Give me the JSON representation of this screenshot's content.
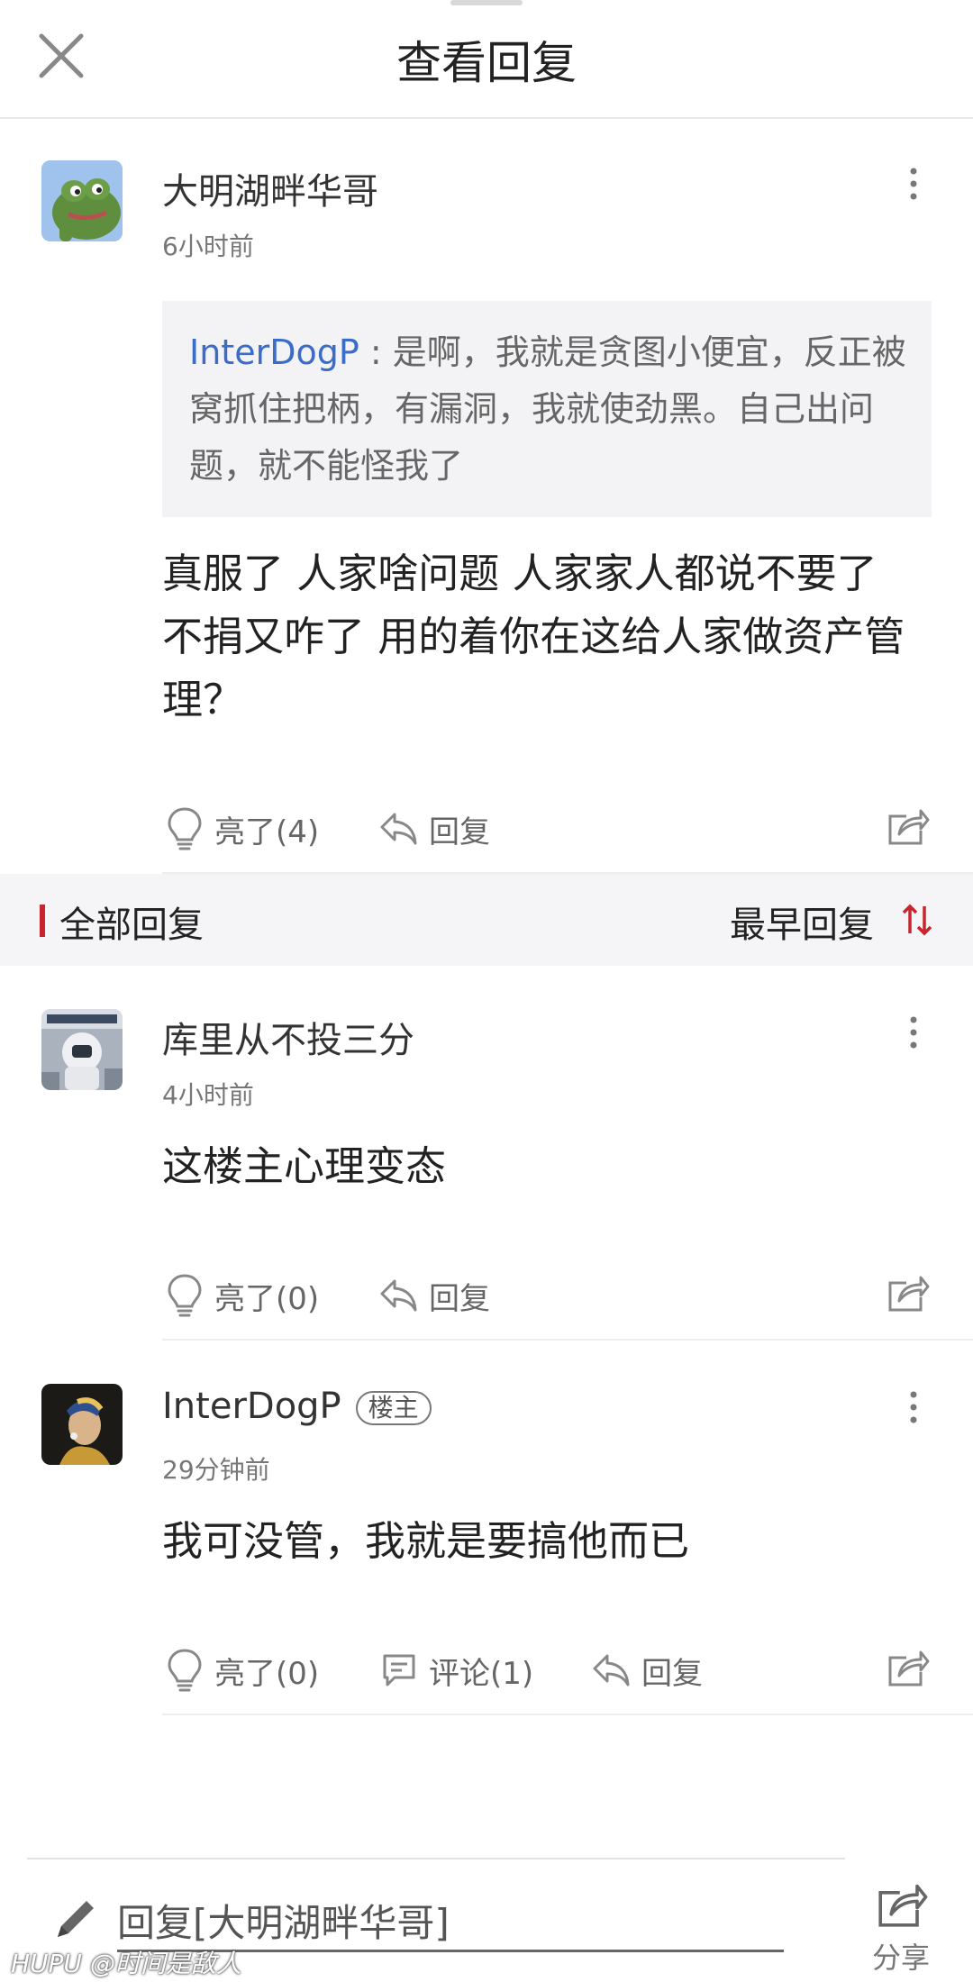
{
  "header": {
    "title": "查看回复",
    "close_icon": "close-icon"
  },
  "main_comment": {
    "username": "大明湖畔华哥",
    "time": "6小时前",
    "quote_user": "InterDogP",
    "quote_sep": " : ",
    "quote_text": "是啊，我就是贪图小便宜，反正被窝抓住把柄，有漏洞，我就使劲黑。自己出问题，就不能怪我了",
    "body": "真服了 人家啥问题 人家家人都说不要了 不捐又咋了 用的着你在这给人家做资产管理？",
    "light_label": "亮了(4)",
    "reply_label": "回复"
  },
  "section": {
    "title": "全部回复",
    "sort_label": "最早回复",
    "accent_color": "#c9252e"
  },
  "replies": [
    {
      "username": "库里从不投三分",
      "time": "4小时前",
      "body": "这楼主心理变态",
      "light_label": "亮了(0)",
      "reply_label": "回复"
    },
    {
      "username": "InterDogP",
      "badge": "楼主",
      "time": "29分钟前",
      "body": "我可没管，我就是要搞他而已",
      "light_label": "亮了(0)",
      "comment_label": "评论(1)",
      "reply_label": "回复"
    }
  ],
  "bottom_bar": {
    "input_placeholder": "回复[大明湖畔华哥]",
    "share_label": "分享"
  },
  "watermark": "HUPU @时间是敌人"
}
